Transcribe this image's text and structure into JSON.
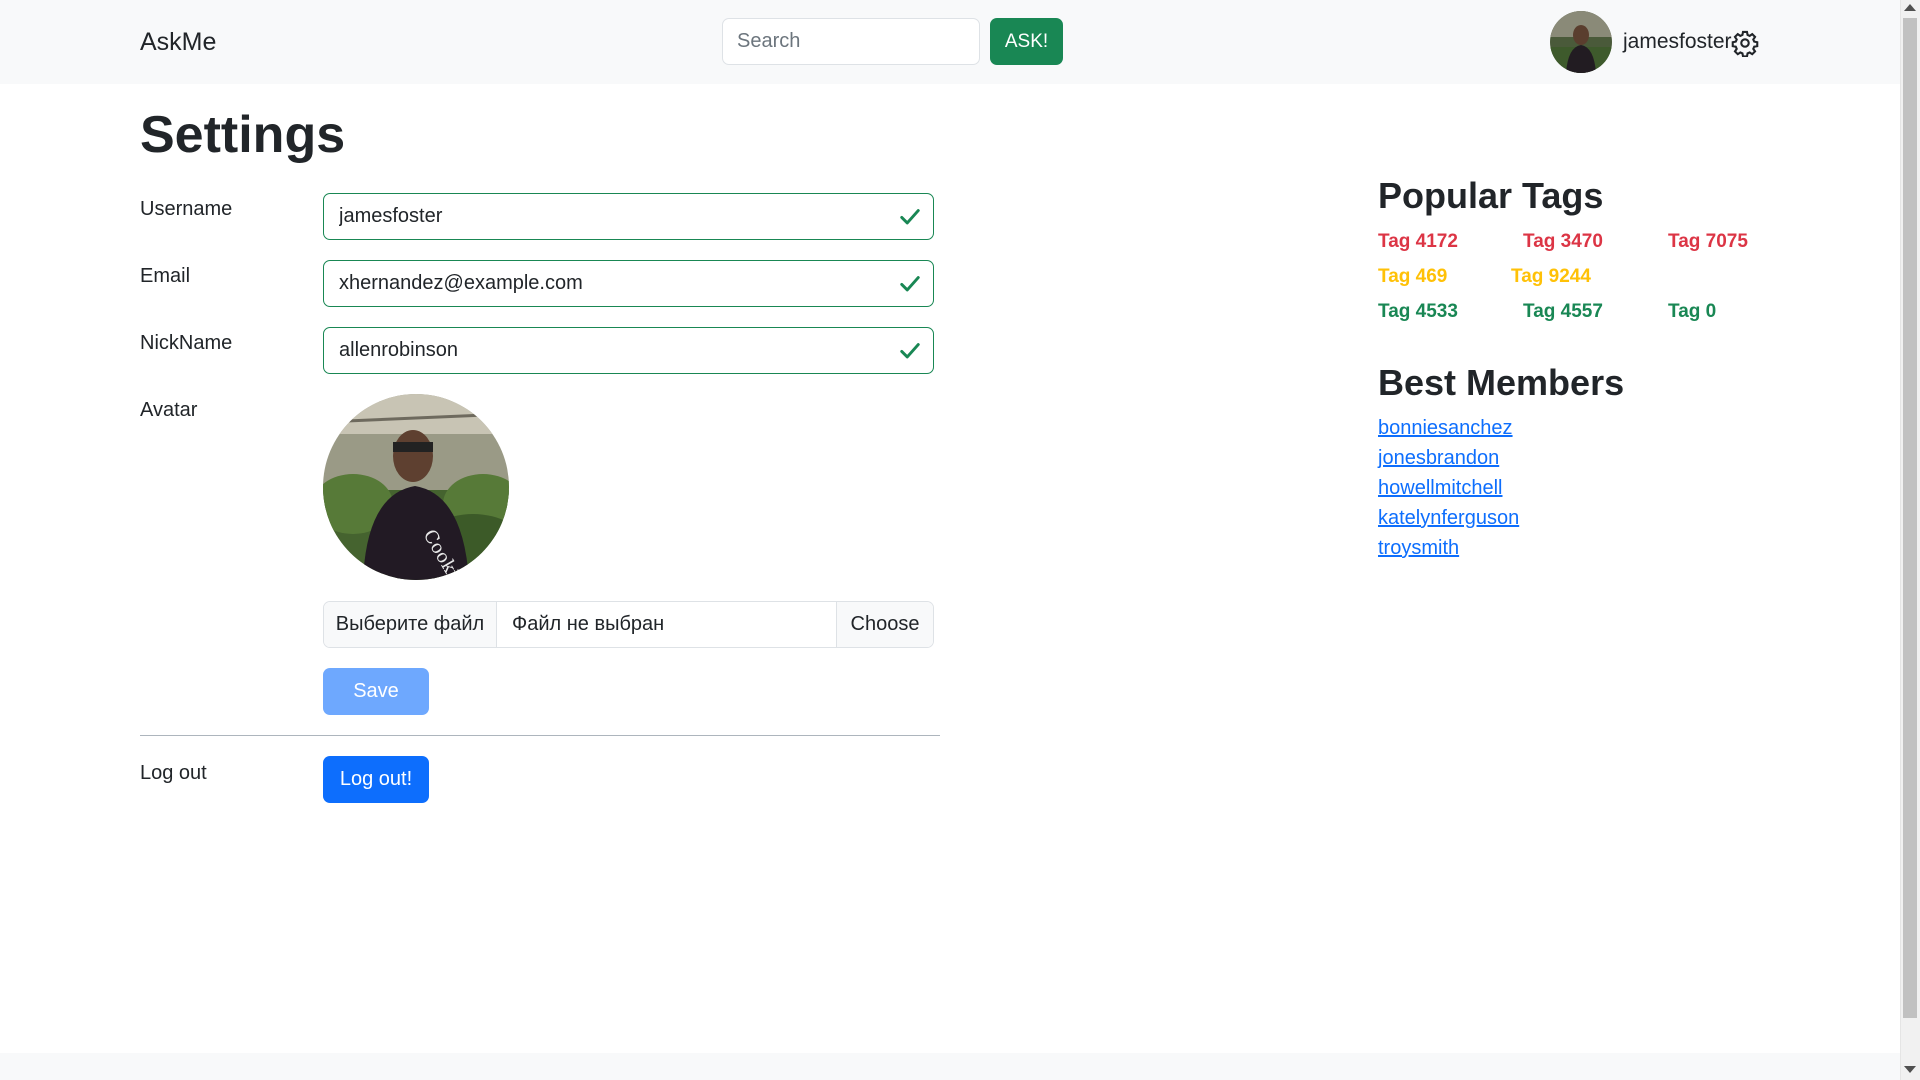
{
  "navbar": {
    "brand": "AskMe",
    "search_placeholder": "Search",
    "ask_label": "ASK!",
    "username": "jamesfoster"
  },
  "settings": {
    "title": "Settings",
    "username_label": "Username",
    "username_value": "jamesfoster",
    "email_label": "Email",
    "email_value": "xhernandez@example.com",
    "nickname_label": "NickName",
    "nickname_value": "allenrobinson",
    "avatar_label": "Avatar",
    "file_button": "Выберите файл",
    "file_status": "Файл не выбран",
    "file_choose": "Choose",
    "save_label": "Save",
    "logout_label": "Log out",
    "logout_button": "Log out!"
  },
  "sidebar": {
    "popular_tags_title": "Popular Tags",
    "tags": [
      {
        "label": "Tag 4172",
        "color": "#dc3545"
      },
      {
        "label": "Tag 3470",
        "color": "#dc3545"
      },
      {
        "label": "Tag 7075",
        "color": "#dc3545"
      },
      {
        "label": "Tag 469",
        "color": "#ffc107"
      },
      {
        "label": "Tag 9244",
        "color": "#ffc107"
      },
      {
        "label": "Tag 4533",
        "color": "#198754"
      },
      {
        "label": "Tag 4557",
        "color": "#198754"
      },
      {
        "label": "Tag 0",
        "color": "#198754"
      }
    ],
    "best_members_title": "Best Members",
    "members": [
      "bonniesanchez",
      "jonesbrandon",
      "howellmitchell",
      "katelynferguson",
      "troysmith"
    ]
  },
  "colors": {
    "success": "#198754",
    "primary": "#0d6efd",
    "primary_disabled": "#6ea8fe",
    "danger": "#dc3545",
    "warning": "#ffc107"
  },
  "icons": [
    "gear-icon",
    "check-icon",
    "avatar-photo"
  ]
}
